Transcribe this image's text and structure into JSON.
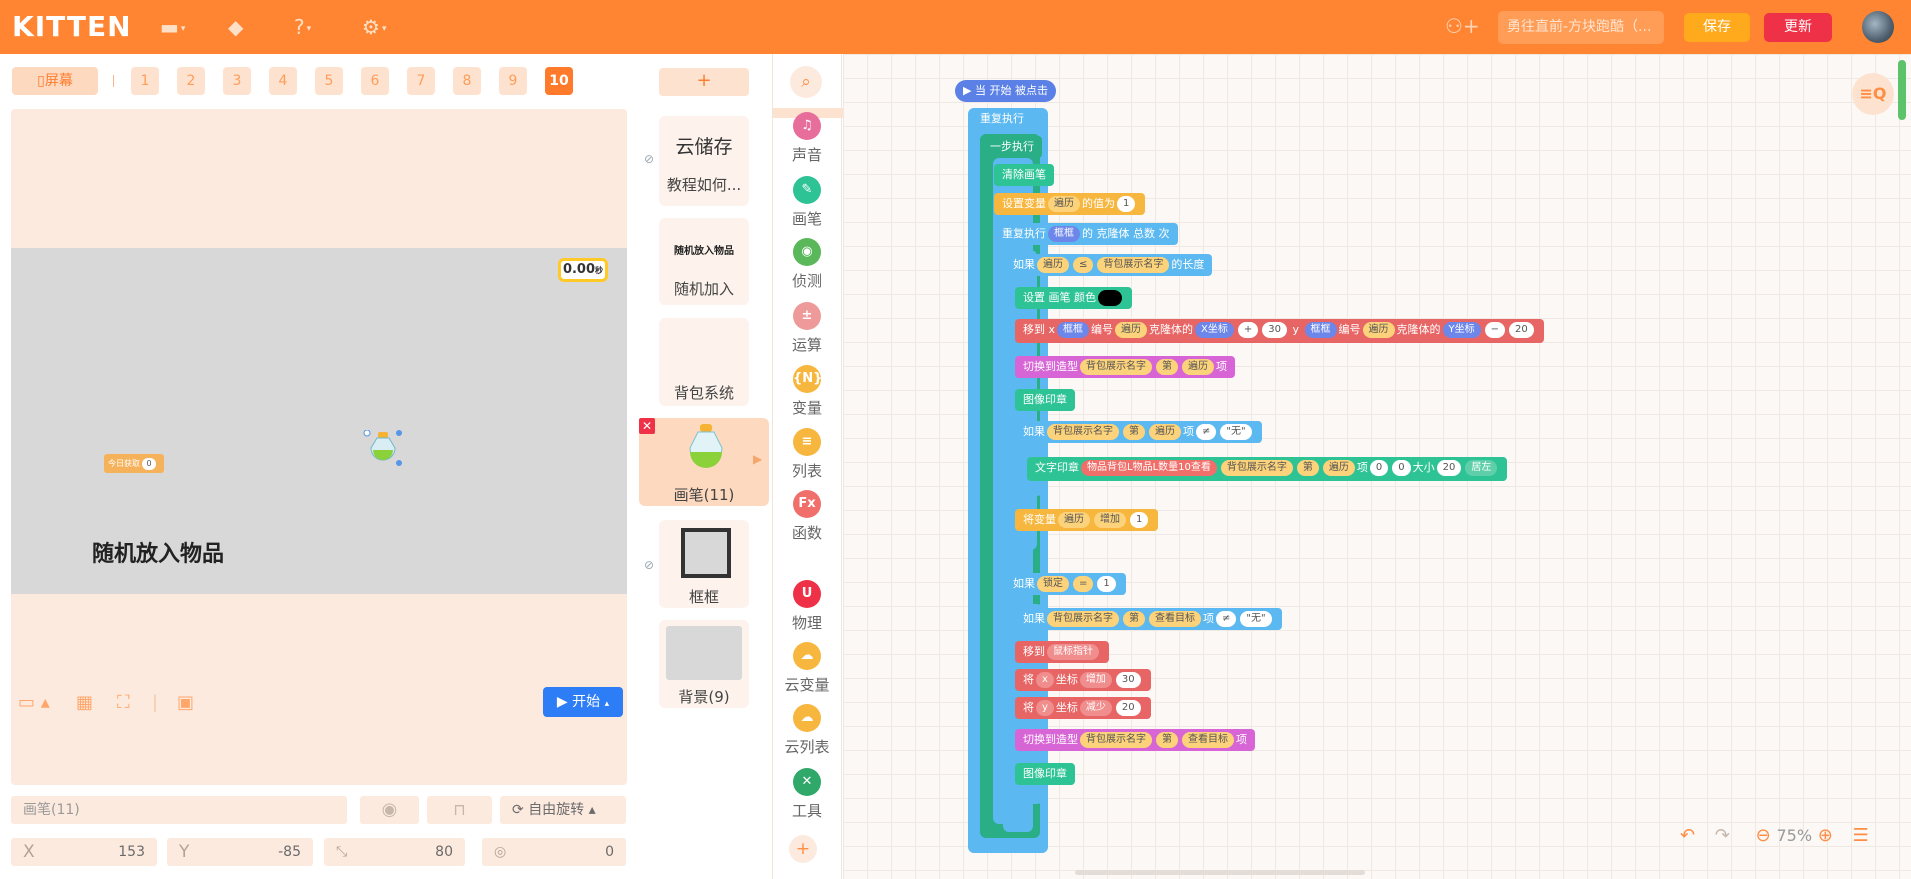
{
  "app": {
    "logo": "KITTEN",
    "project_title": "勇往直前-方块跑酷（...",
    "save_label": "保存",
    "update_label": "更新"
  },
  "toolbar_icons": [
    "folder-icon",
    "backpack-icon",
    "help-icon",
    "settings-icon"
  ],
  "stage": {
    "screen_label": "屏幕",
    "scenes": [
      "1",
      "2",
      "3",
      "4",
      "5",
      "6",
      "7",
      "8",
      "9",
      "10"
    ],
    "active_scene": "10",
    "timer": "0.00",
    "timer_unit": "秒",
    "var_monitor_label": "今日获取",
    "var_monitor_value": "0",
    "canvas_text": "随机放入物品",
    "start_label": "开始"
  },
  "sprite_props": {
    "name": "画笔(11)",
    "rotation": "自由旋转",
    "x_label": "X",
    "x": "153",
    "y_label": "Y",
    "y": "-85",
    "size": "80",
    "direction": "0"
  },
  "sprites": [
    {
      "label": "云储存",
      "sub": "教程如何..."
    },
    {
      "label": "随机放入物品",
      "sub": "随机加入"
    },
    {
      "label": "",
      "sub": "背包系统"
    },
    {
      "label": "",
      "sub": "画笔(11)"
    },
    {
      "label": "",
      "sub": "框框"
    },
    {
      "label": "",
      "sub": "背景(9)"
    }
  ],
  "categories": [
    {
      "label": "声音",
      "icon": "♫",
      "color": "#e76d9b"
    },
    {
      "label": "画笔",
      "icon": "✎",
      "color": "#2ec395"
    },
    {
      "label": "侦测",
      "icon": "◉",
      "color": "#5ab85b"
    },
    {
      "label": "运算",
      "icon": "±",
      "color": "#ee9a9a"
    },
    {
      "label": "变量",
      "icon": "{N}",
      "color": "#f7b63d"
    },
    {
      "label": "列表",
      "icon": "≡",
      "color": "#f7b63d"
    },
    {
      "label": "函数",
      "icon": "Fx",
      "color": "#f06f6a"
    },
    {
      "label": "物理",
      "icon": "U",
      "color": "#ef3148"
    },
    {
      "label": "云变量",
      "icon": "☁",
      "color": "#f7b63d"
    },
    {
      "label": "云列表",
      "icon": "☁",
      "color": "#f7b63d"
    },
    {
      "label": "工具",
      "icon": "✕",
      "color": "#2fa86a"
    }
  ],
  "blocks": {
    "hat": "当 开始 被点击",
    "repeat": "重复执行",
    "step": "一步执行",
    "clear": "清除画笔",
    "set_var": "设置变量",
    "var_traverse": "遍历",
    "of_value": "的值为",
    "one": "1",
    "repeat_n": "重复执行",
    "frame": "框框",
    "clone_total": "的 克隆体 总数",
    "times": "次",
    "if": "如果",
    "bag_names": "背包展示名字",
    "length": "的长度",
    "le": "≤",
    "set_pen_color": "设置 画笔 颜色",
    "move_to_x": "移到 x",
    "index": "编号",
    "clone_x": "克隆体的",
    "x_coord": "X坐标",
    "plus": "+",
    "thirty": "30",
    "y": "y",
    "y_coord": "Y坐标",
    "minus": "−",
    "twenty": "20",
    "switch_costume": "切换到造型",
    "nth": "第",
    "item": "项",
    "stamp": "图像印章",
    "neq": "≠",
    "none_str": "\"无\"",
    "text_stamp": "文字印章",
    "text_prefix": "物品背包L物品L数量10查看",
    "zero": "0",
    "size": "大小",
    "left": "居左",
    "change_var": "将变量",
    "increase": "增加",
    "lock": "锁定",
    "eq": "=",
    "view_target": "查看目标",
    "move_to": "移到",
    "mouse": "鼠标指针",
    "set": "将",
    "x": "x",
    "coord": "坐标",
    "y2": "y",
    "decrease": "减少"
  },
  "zoom": "75%"
}
